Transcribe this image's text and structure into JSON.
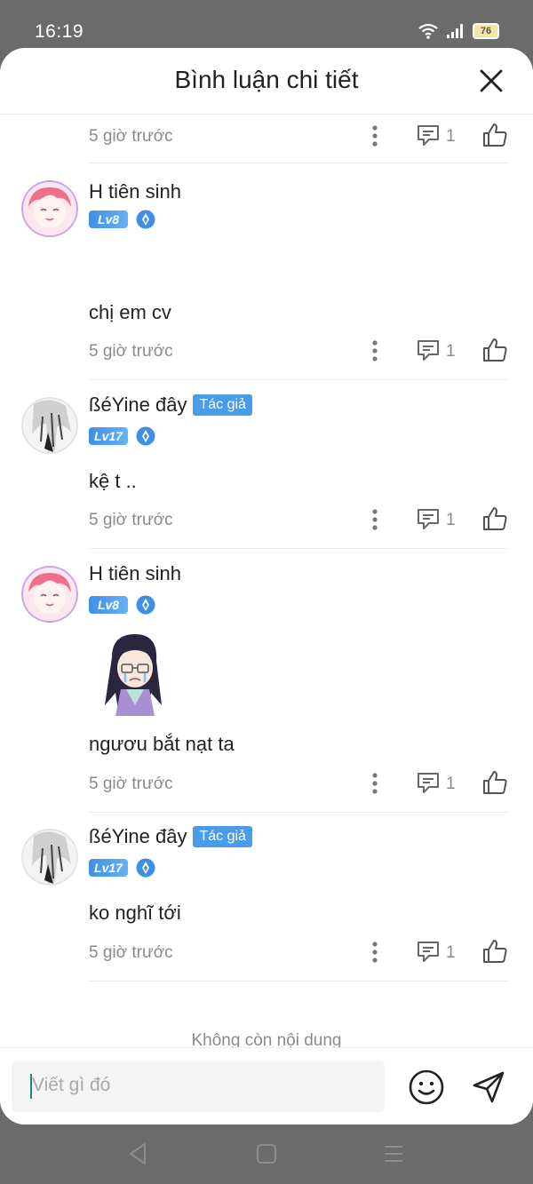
{
  "status_bar": {
    "time": "16:19",
    "battery": "76"
  },
  "header": {
    "title": "Bình luận chi tiết"
  },
  "comments": [
    {
      "timestamp": "5 giờ trước",
      "reply_count": "1"
    },
    {
      "username": "H tiên sinh",
      "level": "Lv8",
      "text": "chị em cv",
      "timestamp": "5 giờ trước",
      "reply_count": "1"
    },
    {
      "username": "ßéYine đây",
      "author_badge": "Tác giả",
      "level": "Lv17",
      "text": "kệ t ..",
      "timestamp": "5 giờ trước",
      "reply_count": "1"
    },
    {
      "username": "H tiên sinh",
      "level": "Lv8",
      "text": "ngươu bắt nạt ta",
      "timestamp": "5 giờ trước",
      "reply_count": "1"
    },
    {
      "username": "ßéYine đây",
      "author_badge": "Tác giả",
      "level": "Lv17",
      "text": "ko nghĩ tới",
      "timestamp": "5 giờ trước",
      "reply_count": "1"
    }
  ],
  "end_of_list": "Không còn nội dung",
  "input": {
    "placeholder": "Viết gì đó"
  },
  "colors": {
    "accent_blue": "#4a9be8",
    "level_blue": "#4a9be8",
    "caret": "#1a8a74",
    "backdrop": "#6b6b6b"
  },
  "icons": [
    "wifi-icon",
    "signal-icon",
    "battery-icon",
    "close-icon",
    "more-vertical-icon",
    "reply-icon",
    "like-icon",
    "crystal-icon",
    "emoji-icon",
    "send-icon",
    "back-nav-icon",
    "home-nav-icon",
    "menu-nav-icon"
  ]
}
